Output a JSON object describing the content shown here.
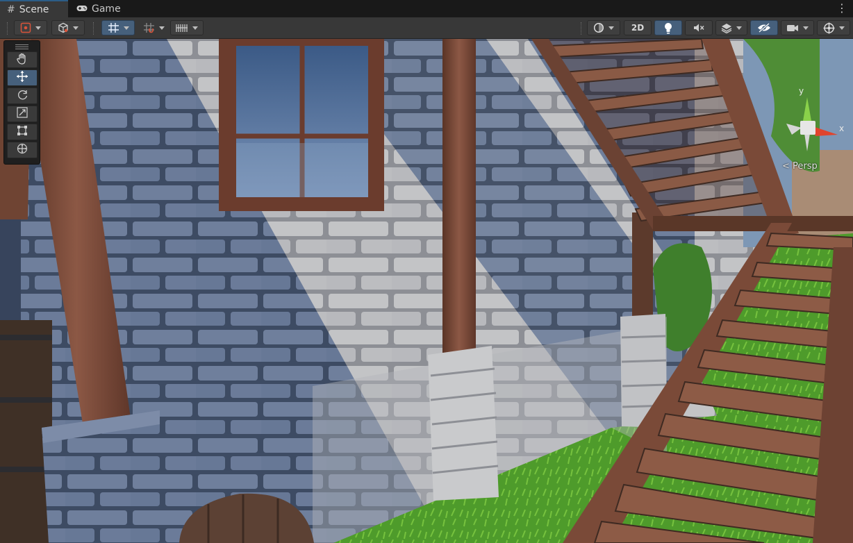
{
  "tabs": [
    {
      "label": "Scene",
      "icon": "grid-hash-icon",
      "active": true
    },
    {
      "label": "Game",
      "icon": "gamepad-icon",
      "active": false
    }
  ],
  "toolbar": {
    "mode_2d_label": "2D",
    "draw_mode_icon": "shading-circle-icon",
    "lighting_icon": "lightbulb-icon",
    "audio_icon": "speaker-mute-icon",
    "effects_icon": "layers-icon",
    "visibility_icon": "eye-crossed-icon",
    "camera_icon": "camera-icon",
    "gizmos_icon": "gizmo-globe-icon"
  },
  "tools": [
    {
      "name": "hand-tool",
      "icon": "hand-icon",
      "active": false
    },
    {
      "name": "move-tool",
      "icon": "move-arrows-icon",
      "active": true
    },
    {
      "name": "rotate-tool",
      "icon": "rotate-icon",
      "active": false
    },
    {
      "name": "scale-tool",
      "icon": "scale-icon",
      "active": false
    },
    {
      "name": "rect-tool",
      "icon": "rect-icon",
      "active": false
    },
    {
      "name": "transform-tool",
      "icon": "transform-icon",
      "active": false
    }
  ],
  "orientation_gizmo": {
    "axis_y_label": "y",
    "axis_x_label": "x",
    "projection_label": "Persp"
  },
  "colors": {
    "accent": "#46607c",
    "axis_y": "#8ad14a",
    "axis_x": "#e0442c",
    "stone": "#aeb0b6",
    "wood": "#7a4a38",
    "grass": "#4f9a2a"
  }
}
